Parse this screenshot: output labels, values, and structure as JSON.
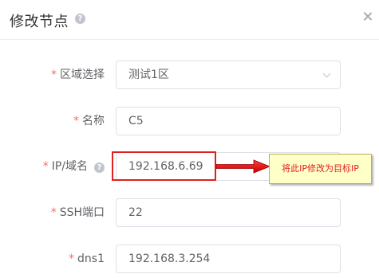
{
  "header": {
    "title": "修改节点",
    "help_icon": "question-circle-icon",
    "close_icon": "close-icon"
  },
  "form": {
    "fields": [
      {
        "label": "区域选择",
        "required": true,
        "value": "测试1区",
        "type": "select"
      },
      {
        "label": "名称",
        "required": true,
        "value": "C5",
        "type": "input"
      },
      {
        "label": "IP/域名",
        "required": true,
        "value": "192.168.6.69",
        "type": "input",
        "has_help": true
      },
      {
        "label": "SSH端口",
        "required": true,
        "value": "22",
        "type": "input"
      },
      {
        "label": "dns1",
        "required": true,
        "value": "192.168.3.254",
        "type": "input"
      }
    ],
    "required_mark": "*"
  },
  "annotation": {
    "callout_text": "将此IP修改为目标IP",
    "highlight_color": "#e02020",
    "callout_background": "#ffffc8"
  }
}
